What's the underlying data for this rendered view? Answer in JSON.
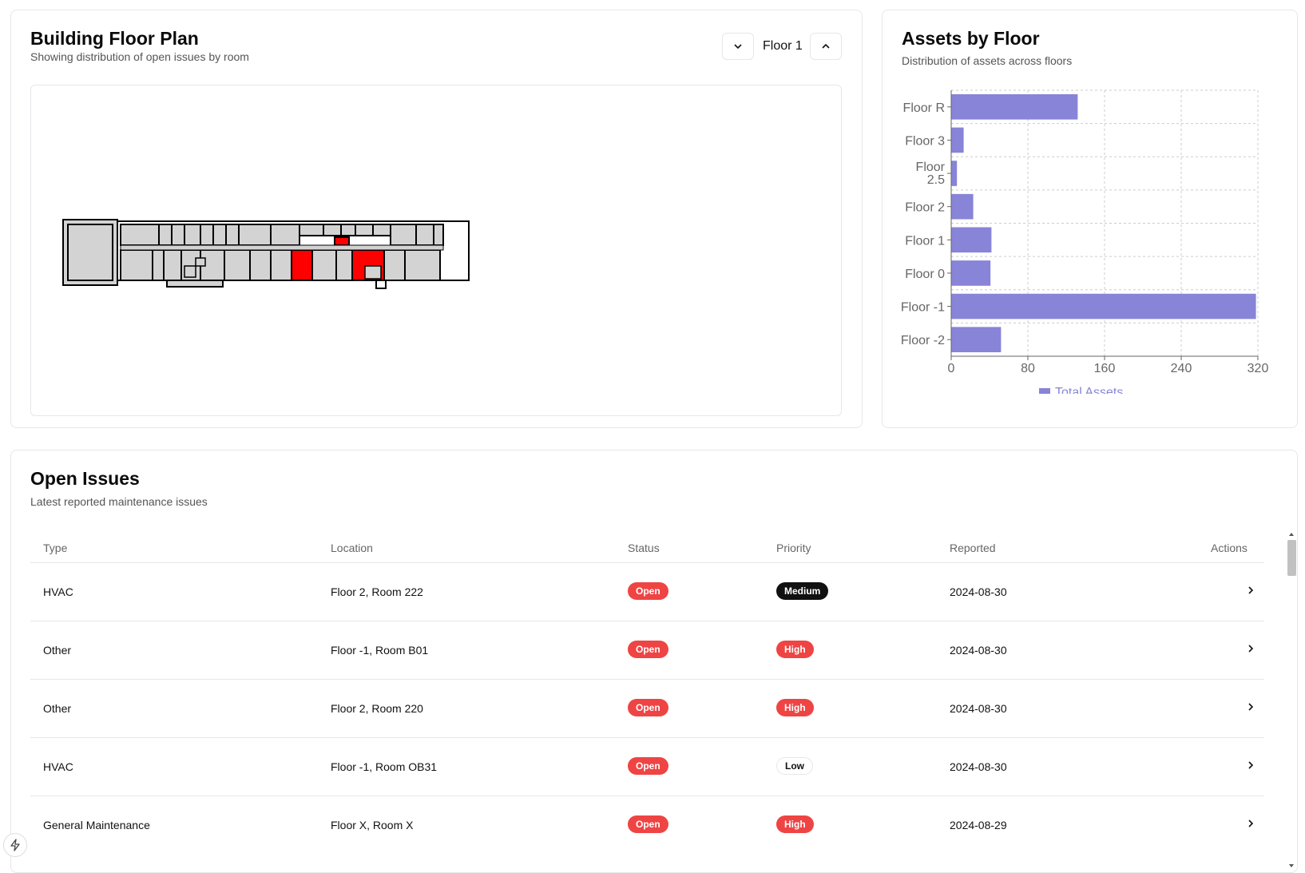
{
  "floor_plan": {
    "title": "Building Floor Plan",
    "subtitle": "Showing distribution of open issues by room",
    "selected_floor": "Floor 1",
    "room_fill_color": "#d3d3d3",
    "highlight_color": "#ff0000"
  },
  "assets": {
    "title": "Assets by Floor",
    "subtitle": "Distribution of assets across floors"
  },
  "chart_data": {
    "type": "bar",
    "orientation": "horizontal",
    "categories": [
      "Floor R",
      "Floor 3",
      "Floor 2.5",
      "Floor 2",
      "Floor 1",
      "Floor 0",
      "Floor -1",
      "Floor -2"
    ],
    "series": [
      {
        "name": "Total Assets",
        "values": [
          132,
          13,
          6,
          23,
          42,
          41,
          318,
          52
        ],
        "color": "#8884d8"
      }
    ],
    "xlim": [
      0,
      320
    ],
    "xticks": [
      0,
      80,
      160,
      240,
      320
    ],
    "grid": true,
    "legend": "bottom"
  },
  "issues": {
    "title": "Open Issues",
    "subtitle": "Latest reported maintenance issues",
    "columns": [
      "Type",
      "Location",
      "Status",
      "Priority",
      "Reported",
      "Actions"
    ],
    "rows": [
      {
        "type": "HVAC",
        "location": "Floor 2, Room 222",
        "status": "Open",
        "priority": "Medium",
        "reported": "2024-08-30"
      },
      {
        "type": "Other",
        "location": "Floor -1, Room B01",
        "status": "Open",
        "priority": "High",
        "reported": "2024-08-30"
      },
      {
        "type": "Other",
        "location": "Floor 2, Room 220",
        "status": "Open",
        "priority": "High",
        "reported": "2024-08-30"
      },
      {
        "type": "HVAC",
        "location": "Floor -1, Room OB31",
        "status": "Open",
        "priority": "Low",
        "reported": "2024-08-30"
      },
      {
        "type": "General Maintenance",
        "location": "Floor X, Room X",
        "status": "Open",
        "priority": "High",
        "reported": "2024-08-29"
      }
    ]
  },
  "icons": {
    "prev_floor": "chevron-down-icon",
    "next_floor": "chevron-up-icon",
    "row_action": "chevron-right-icon",
    "dev_tools": "bolt-icon"
  }
}
